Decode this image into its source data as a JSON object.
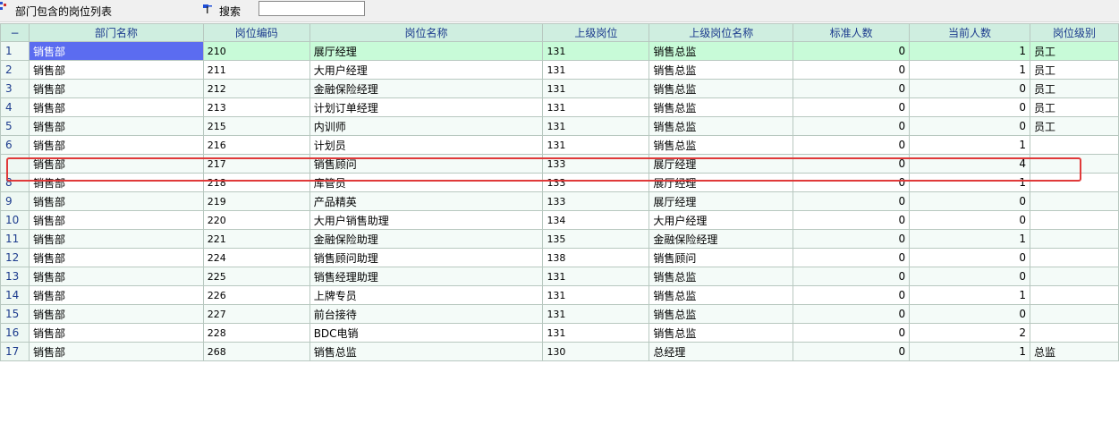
{
  "toolbar": {
    "title": "部门包含的岗位列表",
    "search_label": "搜索",
    "search_value": ""
  },
  "table": {
    "corner": "−",
    "columns": [
      "部门名称",
      "岗位编码",
      "岗位名称",
      "上级岗位",
      "上级岗位名称",
      "标准人数",
      "当前人数",
      "岗位级别"
    ],
    "rows": [
      {
        "idx": "1",
        "dept": "销售部",
        "code": "210",
        "name": "展厅经理",
        "parent": "131",
        "parent_name": "销售总监",
        "std": "0",
        "cur": "1",
        "level": "员工"
      },
      {
        "idx": "2",
        "dept": "销售部",
        "code": "211",
        "name": "大用户经理",
        "parent": "131",
        "parent_name": "销售总监",
        "std": "0",
        "cur": "1",
        "level": "员工"
      },
      {
        "idx": "3",
        "dept": "销售部",
        "code": "212",
        "name": "金融保险经理",
        "parent": "131",
        "parent_name": "销售总监",
        "std": "0",
        "cur": "0",
        "level": "员工"
      },
      {
        "idx": "4",
        "dept": "销售部",
        "code": "213",
        "name": "计划订单经理",
        "parent": "131",
        "parent_name": "销售总监",
        "std": "0",
        "cur": "0",
        "level": "员工"
      },
      {
        "idx": "5",
        "dept": "销售部",
        "code": "215",
        "name": "内训师",
        "parent": "131",
        "parent_name": "销售总监",
        "std": "0",
        "cur": "0",
        "level": "员工"
      },
      {
        "idx": "6",
        "dept": "销售部",
        "code": "216",
        "name": "计划员",
        "parent": "131",
        "parent_name": "销售总监",
        "std": "0",
        "cur": "1",
        "level": ""
      },
      {
        "idx": "",
        "dept": "销售部",
        "code": "217",
        "name": "销售顾问",
        "parent": "133",
        "parent_name": "展厅经理",
        "std": "0",
        "cur": "4",
        "level": ""
      },
      {
        "idx": "8",
        "dept": "销售部",
        "code": "218",
        "name": "库管员",
        "parent": "133",
        "parent_name": "展厅经理",
        "std": "0",
        "cur": "1",
        "level": ""
      },
      {
        "idx": "9",
        "dept": "销售部",
        "code": "219",
        "name": "产品精英",
        "parent": "133",
        "parent_name": "展厅经理",
        "std": "0",
        "cur": "0",
        "level": ""
      },
      {
        "idx": "10",
        "dept": "销售部",
        "code": "220",
        "name": "大用户销售助理",
        "parent": "134",
        "parent_name": "大用户经理",
        "std": "0",
        "cur": "0",
        "level": ""
      },
      {
        "idx": "11",
        "dept": "销售部",
        "code": "221",
        "name": "金融保险助理",
        "parent": "135",
        "parent_name": "金融保险经理",
        "std": "0",
        "cur": "1",
        "level": ""
      },
      {
        "idx": "12",
        "dept": "销售部",
        "code": "224",
        "name": "销售顾问助理",
        "parent": "138",
        "parent_name": "销售顾问",
        "std": "0",
        "cur": "0",
        "level": ""
      },
      {
        "idx": "13",
        "dept": "销售部",
        "code": "225",
        "name": "销售经理助理",
        "parent": "131",
        "parent_name": "销售总监",
        "std": "0",
        "cur": "0",
        "level": ""
      },
      {
        "idx": "14",
        "dept": "销售部",
        "code": "226",
        "name": "上牌专员",
        "parent": "131",
        "parent_name": "销售总监",
        "std": "0",
        "cur": "1",
        "level": ""
      },
      {
        "idx": "15",
        "dept": "销售部",
        "code": "227",
        "name": "前台接待",
        "parent": "131",
        "parent_name": "销售总监",
        "std": "0",
        "cur": "0",
        "level": ""
      },
      {
        "idx": "16",
        "dept": "销售部",
        "code": "228",
        "name": "BDC电销",
        "parent": "131",
        "parent_name": "销售总监",
        "std": "0",
        "cur": "2",
        "level": ""
      },
      {
        "idx": "17",
        "dept": "销售部",
        "code": "268",
        "name": "销售总监",
        "parent": "130",
        "parent_name": "总经理",
        "std": "0",
        "cur": "1",
        "level": "总监"
      }
    ]
  },
  "colors": {
    "header_bg": "#cfeee0",
    "header_text": "#1d3c8e",
    "selected_row": "#c8fbd8",
    "active_cell": "#5b6cf0",
    "highlight_box": "#e03a3a"
  },
  "icons": {
    "toolbar_list": "list-icon",
    "search": "search-flag-icon"
  }
}
